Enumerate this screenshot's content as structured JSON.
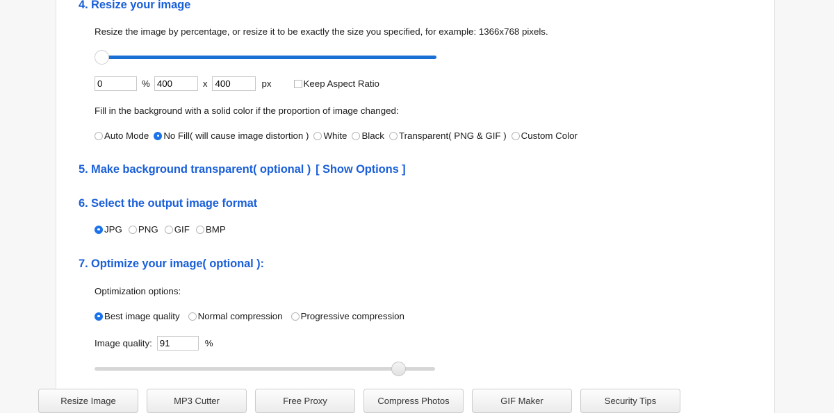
{
  "sections": {
    "resize": {
      "heading": "4. Resize your image",
      "description": "Resize the image by percentage, or resize it to be exactly the size you specified, for example: 1366x768 pixels.",
      "slider_value": 0,
      "percent_value": "0",
      "percent_unit": "%",
      "width_value": "400",
      "dimension_separator": "x",
      "height_value": "400",
      "pixel_unit": "px",
      "keep_aspect_ratio": {
        "label": "Keep Aspect Ratio",
        "checked": false
      },
      "fill_description": "Fill in the background with a solid color if the proportion of image changed:",
      "fill_options": [
        {
          "label": "Auto Mode",
          "checked": false
        },
        {
          "label": "No Fill( will cause image distortion )",
          "checked": true
        },
        {
          "label": "White",
          "checked": false
        },
        {
          "label": "Black",
          "checked": false
        },
        {
          "label": "Transparent( PNG & GIF )",
          "checked": false
        },
        {
          "label": "Custom Color",
          "checked": false
        }
      ]
    },
    "transparent": {
      "heading_main": "5. Make background transparent( optional )",
      "heading_link": "[ Show Options ]"
    },
    "format": {
      "heading": "6. Select the output image format",
      "options": [
        {
          "label": "JPG",
          "checked": true
        },
        {
          "label": "PNG",
          "checked": false
        },
        {
          "label": "GIF",
          "checked": false
        },
        {
          "label": "BMP",
          "checked": false
        }
      ]
    },
    "optimize": {
      "heading": "7. Optimize your image( optional ):",
      "options_label": "Optimization options:",
      "options": [
        {
          "label": "Best image quality",
          "checked": true
        },
        {
          "label": "Normal compression",
          "checked": false
        },
        {
          "label": "Progressive compression",
          "checked": false
        }
      ],
      "quality_label": "Image quality:",
      "quality_value": "91",
      "quality_unit": "%",
      "quality_slider_value": 91
    }
  },
  "footer": {
    "buttons": [
      {
        "label": "Resize Image"
      },
      {
        "label": "MP3 Cutter"
      },
      {
        "label": "Free Proxy"
      },
      {
        "label": "Compress Photos"
      },
      {
        "label": "GIF Maker"
      },
      {
        "label": "Security Tips"
      }
    ]
  },
  "colors": {
    "heading_blue": "#1a5fd8",
    "slider_blue": "#1a6fd4",
    "radio_blue": "#1a73e8",
    "page_background": "#f7f7f7",
    "content_background": "#ffffff"
  }
}
